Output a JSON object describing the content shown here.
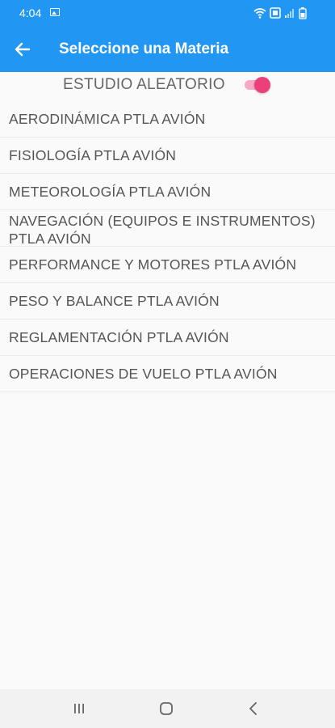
{
  "status_bar": {
    "time": "4:04",
    "icons": [
      "image-icon",
      "wifi-icon",
      "data-saver-icon",
      "signal-icon",
      "battery-icon"
    ]
  },
  "app_bar": {
    "title": "Seleccione una Materia",
    "back_icon": "arrow-left-icon"
  },
  "random_study": {
    "label": "ESTUDIO ALEATORIO",
    "enabled": true
  },
  "subjects": [
    "AERODINÁMICA PTLA AVIÓN",
    "FISIOLOGÍA PTLA AVIÓN",
    "METEOROLOGÍA PTLA AVIÓN",
    "NAVEGACIÓN (EQUIPOS E INSTRUMENTOS) PTLA AVIÓN",
    "PERFORMANCE Y MOTORES PTLA AVIÓN",
    "PESO Y BALANCE PTLA AVIÓN",
    "REGLAMENTACIÓN PTLA AVIÓN",
    "OPERACIONES DE VUELO PTLA AVIÓN"
  ],
  "nav_bar": {
    "icons": [
      "recents-icon",
      "home-icon",
      "back-icon"
    ]
  },
  "colors": {
    "primary": "#2196f3",
    "accent": "#ec407a",
    "text": "#555555",
    "background": "#fafafa"
  }
}
